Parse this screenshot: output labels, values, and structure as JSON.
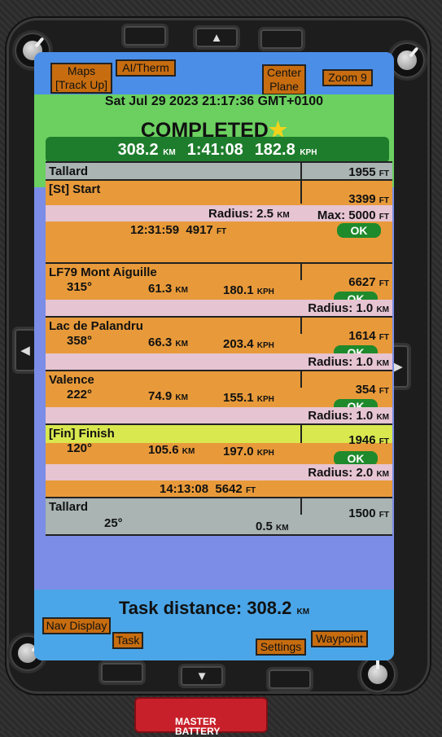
{
  "topbar": {
    "maps": "Maps [Track Up]",
    "aitherm": "AI/Therm",
    "center": "Center Plane",
    "zoom": "Zoom 9"
  },
  "status": {
    "datetime": "Sat Jul 29 2023 21:17:36 GMT+0100",
    "completed": "COMPLETED",
    "distance": "308.2",
    "distance_unit": "KM",
    "duration": "1:41:08",
    "speed": "182.8",
    "speed_unit": "KPH"
  },
  "units": {
    "ft": "FT",
    "km": "KM",
    "kph": "KPH",
    "ok": "OK"
  },
  "waypoints": {
    "depart": {
      "name": "Tallard",
      "alt": "1955"
    },
    "start": {
      "name": "[St] Start",
      "alt": "3399",
      "radius": "Radius: 2.5",
      "max": "Max: 5000",
      "time": "12:31:59",
      "time_alt": "4917"
    },
    "wp1": {
      "name": "LF79 Mont Aiguille",
      "hdg": "315°",
      "dist": "61.3",
      "speed": "180.1",
      "alt": "6627",
      "radius": "Radius: 1.0"
    },
    "wp2": {
      "name": "Lac de Palandru",
      "hdg": "358°",
      "dist": "66.3",
      "speed": "203.4",
      "alt": "1614",
      "radius": "Radius: 1.0"
    },
    "wp3": {
      "name": "Valence",
      "hdg": "222°",
      "dist": "74.9",
      "speed": "155.1",
      "alt": "354",
      "radius": "Radius: 1.0"
    },
    "finish": {
      "name": "[Fin] Finish",
      "hdg": "120°",
      "dist": "105.6",
      "speed": "197.0",
      "alt": "1946",
      "radius": "Radius: 2.0",
      "time": "14:13:08",
      "time_alt": "5642"
    },
    "arrive": {
      "name": "Tallard",
      "hdg": "25°",
      "dist": "0.5",
      "alt": "1500"
    }
  },
  "task": {
    "label": "Task distance: 308.2",
    "unit": "KM"
  },
  "bottombar": {
    "nav": "Nav Display",
    "task": "Task",
    "settings": "Settings",
    "waypoint": "Waypoint"
  },
  "hardware": {
    "up": "▲",
    "down": "▼",
    "left": "◀",
    "right": "▶",
    "master": "MASTER BATTERY"
  },
  "colors": {
    "orange": "#e89a3a",
    "pink": "#e6c4d2",
    "gray": "#a9b4b3",
    "lime": "#d9e84e",
    "ok_green": "#1f8a2c",
    "status_green": "#6bd060"
  }
}
